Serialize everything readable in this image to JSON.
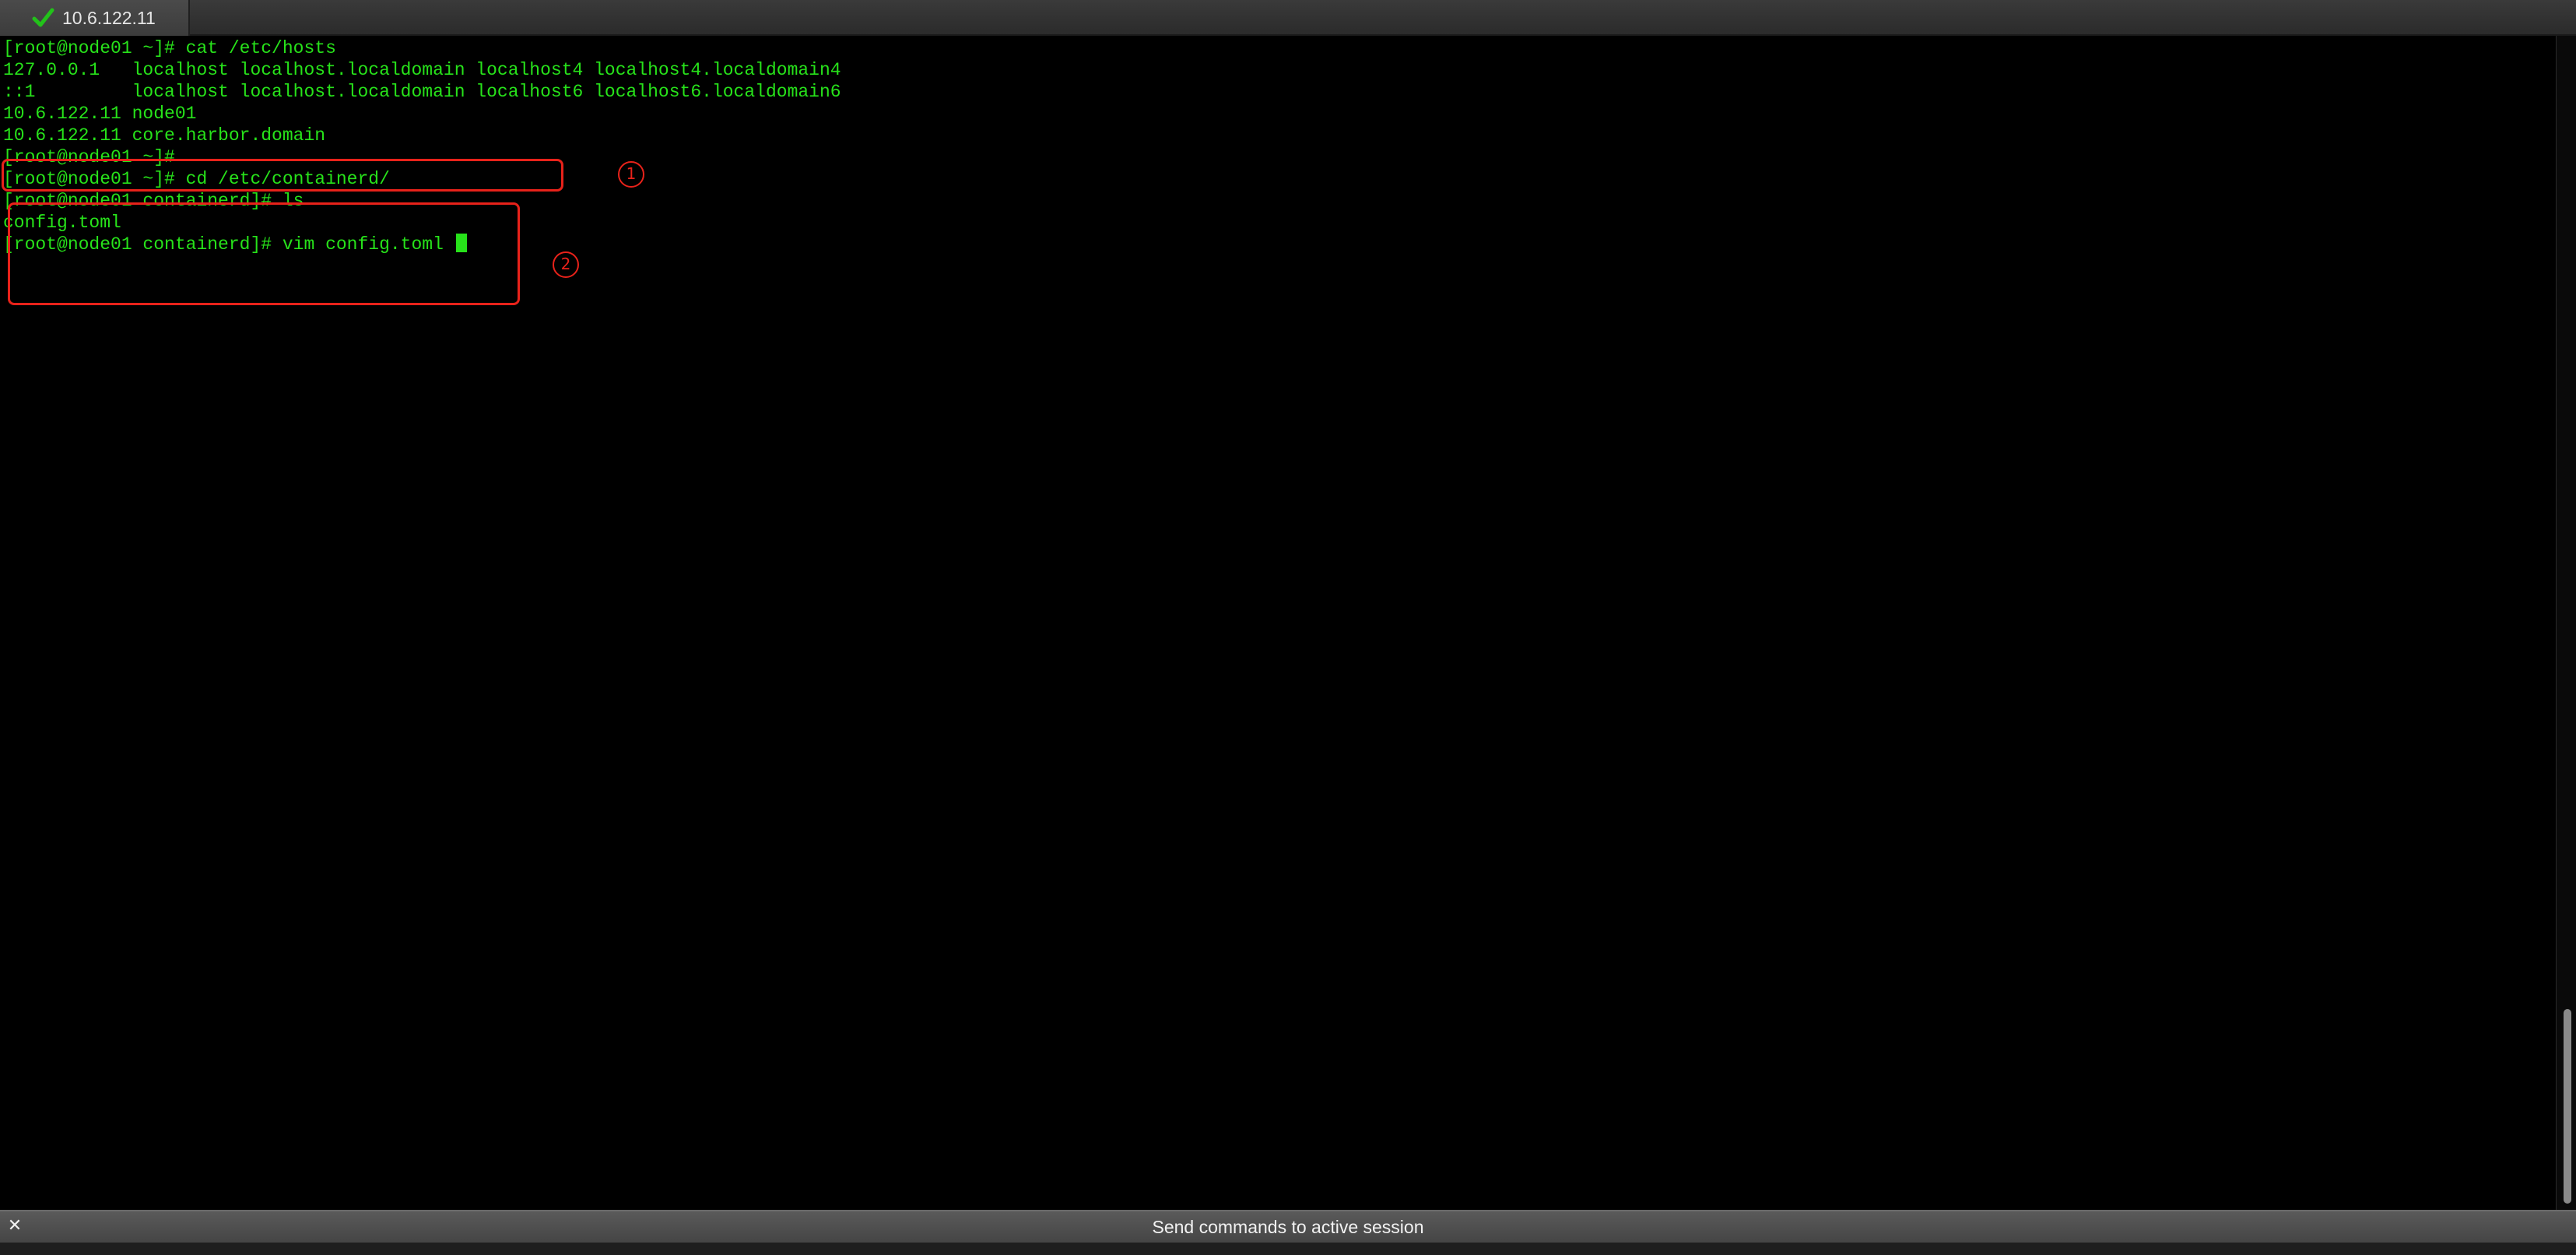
{
  "tab": {
    "title": "10.6.122.11",
    "status_icon": "green-check-icon",
    "status_color": "#22c21a"
  },
  "terminal": {
    "text_color": "#27e21a",
    "lines": [
      "[root@node01 ~]# cat /etc/hosts",
      "127.0.0.1   localhost localhost.localdomain localhost4 localhost4.localdomain4",
      "::1         localhost localhost.localdomain localhost6 localhost6.localdomain6",
      "10.6.122.11 node01",
      "10.6.122.11 core.harbor.domain",
      "[root@node01 ~]#",
      "[root@node01 ~]# cd /etc/containerd/",
      "[root@node01 containerd]# ls",
      "config.toml",
      "[root@node01 containerd]# vim config.toml "
    ]
  },
  "annotations": {
    "color": "#e8221a",
    "labels": [
      "1",
      "2"
    ]
  },
  "command_bar": {
    "label": "Send commands to active session",
    "close_icon": "close-icon"
  }
}
